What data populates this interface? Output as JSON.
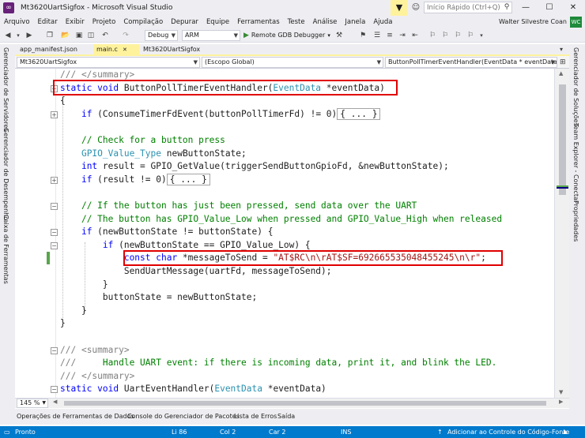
{
  "window": {
    "title": "Mt3620UartSigfox - Microsoft Visual Studio",
    "quick_launch_placeholder": "Início Rápido (Ctrl+Q)",
    "icons": [
      "vs-logo-icon",
      "filter-icon",
      "feedback-icon",
      "search-icon",
      "minimize-icon",
      "maximize-icon",
      "close-icon"
    ]
  },
  "menu": [
    "Arquivo",
    "Editar",
    "Exibir",
    "Projeto",
    "Compilação",
    "Depurar",
    "Equipe",
    "Ferramentas",
    "Teste",
    "Análise",
    "Janela",
    "Ajuda"
  ],
  "user": {
    "name": "Walter Silvestre Coan",
    "initials": "WC"
  },
  "toolbar": {
    "config": "Debug",
    "platform": "ARM",
    "run_label": "Remote GDB Debugger"
  },
  "left_panels": [
    "Gerenciador de Servidores",
    "Gerenciador de Desempenho",
    "Caixa de Ferramentas"
  ],
  "right_panels": [
    "Gerenciador de Soluções",
    "Team Explorer - Conectar",
    "Propriedades"
  ],
  "doc_tabs": [
    {
      "label": "app_manifest.json",
      "active": false
    },
    {
      "label": "main.c",
      "active": true
    },
    {
      "label": "Mt3620UartSigfox",
      "active": false
    }
  ],
  "nav": {
    "project": "Mt3620UartSigfox",
    "scope": "(Escopo Global)",
    "member": "ButtonPollTimerEventHandler(EventData * eventData)"
  },
  "code": {
    "l1_comment": "/// </summary>",
    "l2_kw": "static void",
    "l2_name": " ButtonPollTimerEventHandler(",
    "l2_type": "EventData",
    "l2_param": " *eventData)",
    "l3": "{",
    "l4_kw": "if",
    "l4_rest": " (ConsumeTimerFdEvent(buttonPollTimerFd) != 0)",
    "collapsed": "{ ... }",
    "l6_comment": "// Check for a button press",
    "l7_type": "GPIO_Value_Type",
    "l7_rest": " newButtonState;",
    "l8_kw": "int",
    "l8_rest": " result = GPIO_GetValue(triggerSendButtonGpioFd, &newButtonState);",
    "l9_kw": "if",
    "l9_rest": " (result != 0)",
    "l11_comment": "// If the button has just been pressed, send data over the UART",
    "l12_comment": "// The button has GPIO_Value_Low when pressed and GPIO_Value_High when released",
    "l13_kw": "if",
    "l13_rest": " (newButtonState != buttonState) {",
    "l14_kw": "if",
    "l14_rest": " (newButtonState == GPIO_Value_Low) {",
    "l15_kw": "const char",
    "l15_mid": " *messageToSend = ",
    "l15_str": "\"AT$RC\\n\\rAT$SF=692665535048455245\\n\\r\"",
    "l15_end": ";",
    "l16": "SendUartMessage(uartFd, messageToSend);",
    "l17": "}",
    "l18": "buttonState = newButtonState;",
    "l19": "}",
    "l20": "}",
    "l22_slashes": "///",
    "l22_tag": " <summary>",
    "l23_slashes": "///",
    "l23_text": "     Handle UART event: if there is incoming data, print it, and blink the LED.",
    "l24_slashes": "///",
    "l24_tag": " </summary>",
    "l25_kw": "static void",
    "l25_name": " UartEventHandler(",
    "l25_type": "EventData",
    "l25_param": " *eventData)"
  },
  "zoom": "145 %",
  "bottom_tabs": [
    "Operações de Ferramentas de Dados",
    "Console do Gerenciador de Pacotes",
    "Lista de Erros",
    "Saída"
  ],
  "status": {
    "state": "Pronto",
    "line": "Li 86",
    "col": "Col 2",
    "car": "Car 2",
    "mode": "INS",
    "source_control": "Adicionar ao Controle do Código-Fonte"
  }
}
